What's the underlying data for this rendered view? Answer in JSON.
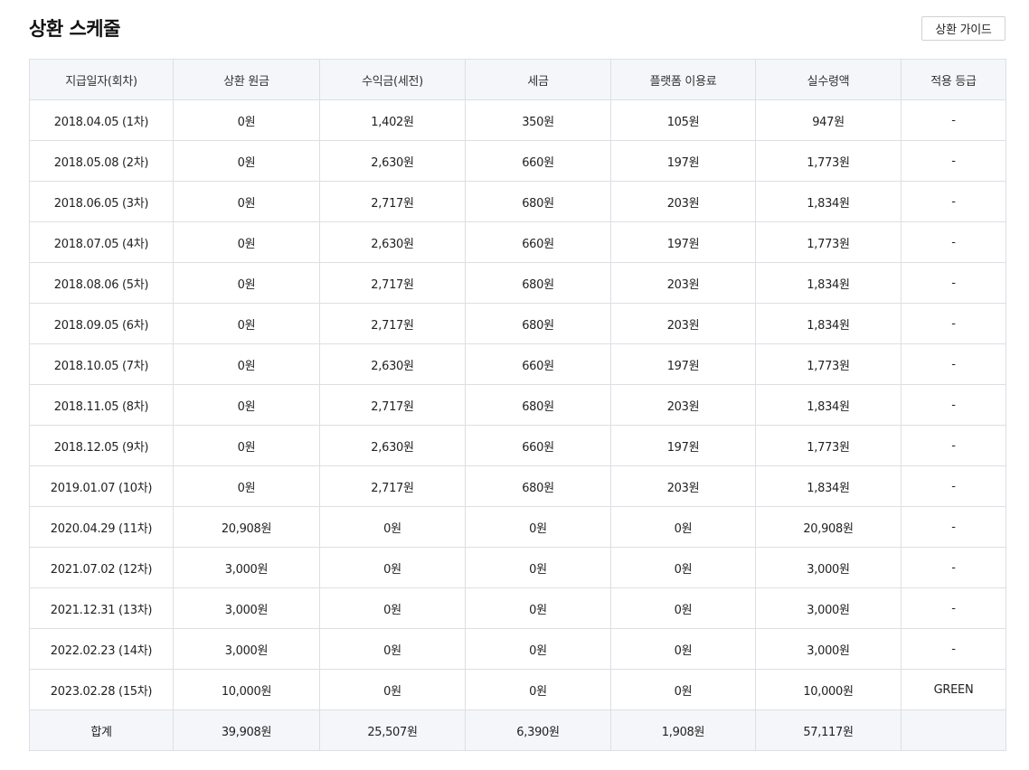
{
  "page": {
    "title": "상환 스케줄",
    "guide_button_label": "상환 가이드"
  },
  "table": {
    "headers": [
      "지급일자(회차)",
      "상환 원금",
      "수익금(세전)",
      "세금",
      "플랫폼 이용료",
      "실수령액",
      "적용 등급"
    ],
    "rows": [
      [
        "2018.04.05 (1차)",
        "0원",
        "1,402원",
        "350원",
        "105원",
        "947원",
        "-"
      ],
      [
        "2018.05.08 (2차)",
        "0원",
        "2,630원",
        "660원",
        "197원",
        "1,773원",
        "-"
      ],
      [
        "2018.06.05 (3차)",
        "0원",
        "2,717원",
        "680원",
        "203원",
        "1,834원",
        "-"
      ],
      [
        "2018.07.05 (4차)",
        "0원",
        "2,630원",
        "660원",
        "197원",
        "1,773원",
        "-"
      ],
      [
        "2018.08.06 (5차)",
        "0원",
        "2,717원",
        "680원",
        "203원",
        "1,834원",
        "-"
      ],
      [
        "2018.09.05 (6차)",
        "0원",
        "2,717원",
        "680원",
        "203원",
        "1,834원",
        "-"
      ],
      [
        "2018.10.05 (7차)",
        "0원",
        "2,630원",
        "660원",
        "197원",
        "1,773원",
        "-"
      ],
      [
        "2018.11.05 (8차)",
        "0원",
        "2,717원",
        "680원",
        "203원",
        "1,834원",
        "-"
      ],
      [
        "2018.12.05 (9차)",
        "0원",
        "2,630원",
        "660원",
        "197원",
        "1,773원",
        "-"
      ],
      [
        "2019.01.07 (10차)",
        "0원",
        "2,717원",
        "680원",
        "203원",
        "1,834원",
        "-"
      ],
      [
        "2020.04.29 (11차)",
        "20,908원",
        "0원",
        "0원",
        "0원",
        "20,908원",
        "-"
      ],
      [
        "2021.07.02 (12차)",
        "3,000원",
        "0원",
        "0원",
        "0원",
        "3,000원",
        "-"
      ],
      [
        "2021.12.31 (13차)",
        "3,000원",
        "0원",
        "0원",
        "0원",
        "3,000원",
        "-"
      ],
      [
        "2022.02.23 (14차)",
        "3,000원",
        "0원",
        "0원",
        "0원",
        "3,000원",
        "-"
      ],
      [
        "2023.02.28 (15차)",
        "10,000원",
        "0원",
        "0원",
        "0원",
        "10,000원",
        "GREEN"
      ]
    ],
    "totals": [
      "합계",
      "39,908원",
      "25,507원",
      "6,390원",
      "1,908원",
      "57,117원",
      ""
    ]
  }
}
